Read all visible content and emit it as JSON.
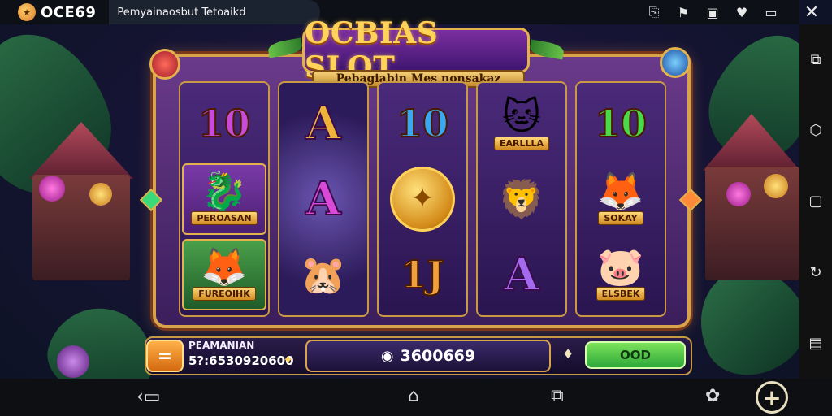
{
  "topbar": {
    "brand": "OCE69",
    "tab_title": "Pemyainaosbut Tetoaikd",
    "icons": [
      "share-icon",
      "bookmark-icon",
      "image-icon",
      "shield-icon",
      "window-icon",
      "close-icon"
    ]
  },
  "game": {
    "title": "OCBIAS SLOT",
    "subtitle": "Pebagiabin Mes nonsakaz",
    "reels": [
      [
        {
          "kind": "number",
          "text": "10",
          "color": "#c74ad9"
        },
        {
          "kind": "animal",
          "glyph": "🐉",
          "caption": "PEROASAN",
          "boxed": "purple"
        },
        {
          "kind": "animal",
          "glyph": "🦊",
          "caption": "FUREOIHK",
          "boxed": "green"
        }
      ],
      [
        {
          "kind": "letter",
          "text": "A",
          "color": "#f0b33a"
        },
        {
          "kind": "letter",
          "text": "A",
          "color": "#d94ad9"
        },
        {
          "kind": "animal",
          "glyph": "🐹"
        }
      ],
      [
        {
          "kind": "number",
          "text": "10",
          "color": "#3aa8f0"
        },
        {
          "kind": "coin",
          "glyph": "✦"
        },
        {
          "kind": "number",
          "text": "1J",
          "color": "#f0a13a"
        }
      ],
      [
        {
          "kind": "animal",
          "glyph": "🐱",
          "caption": "EARLLLA"
        },
        {
          "kind": "animal",
          "glyph": "🦁"
        },
        {
          "kind": "letter",
          "text": "A",
          "color": "#a36af0"
        }
      ],
      [
        {
          "kind": "number",
          "text": "10",
          "color": "#4ad94a"
        },
        {
          "kind": "animal",
          "glyph": "🦊",
          "caption": "SOKAY"
        },
        {
          "kind": "animal",
          "glyph": "🐷",
          "caption": "ELSBEK"
        }
      ]
    ]
  },
  "controls": {
    "menu_glyph": "=",
    "balance_label": "PEAMANIAN",
    "balance_value": "5?:6530920600",
    "bet_value": "3600669",
    "spin_label": "OOD"
  },
  "colors": {
    "frame_gold": "#d9a34a",
    "spin_green": "#2ea83a"
  }
}
